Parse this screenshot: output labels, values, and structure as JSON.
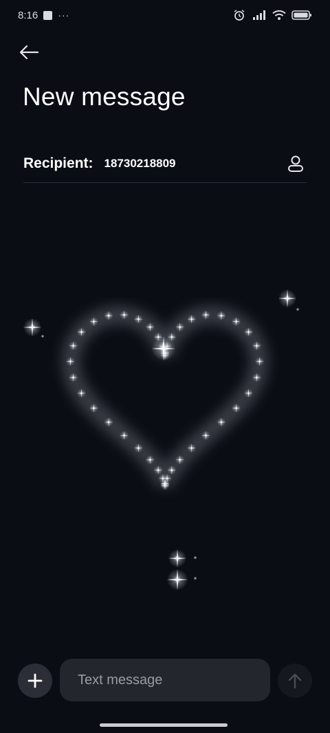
{
  "status_bar": {
    "time": "8:16",
    "notification_icon": "square-notification-icon",
    "more_label": "···",
    "icons": [
      "alarm-icon",
      "signal-icon",
      "wifi-icon",
      "battery-icon"
    ]
  },
  "header": {
    "back_icon": "arrow-left-icon",
    "title": "New message"
  },
  "recipient": {
    "label": "Recipient:",
    "value": "18730218809",
    "contact_icon": "person-icon"
  },
  "composer": {
    "add_icon": "plus-icon",
    "placeholder": "Text message",
    "value": "",
    "send_icon": "arrow-up-icon"
  },
  "colors": {
    "background": "#0a0d14",
    "text": "#ffffff",
    "input_bg": "#23262d",
    "divider": "#2a2e37"
  }
}
